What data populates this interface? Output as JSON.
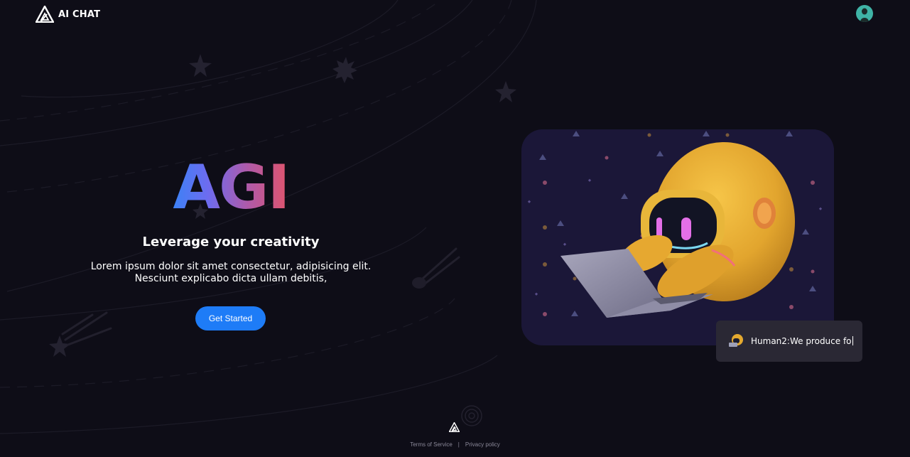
{
  "header": {
    "brand_name": "AI CHAT",
    "logo_icon": "triangle-logo-icon",
    "avatar_icon": "user-avatar-icon"
  },
  "hero": {
    "title": "AGI",
    "subtitle": "Leverage your creativity",
    "description_line1": "Lorem ipsum dolor sit amet consectetur, adipisicing elit.",
    "description_line2": "Nesciunt explicabo dicta ullam debitis,",
    "cta_label": "Get Started"
  },
  "illustration": {
    "icon": "robot-with-laptop-illustration"
  },
  "chat_bubble": {
    "text": "Human2:We produce fo",
    "avatar_icon": "robot-avatar-icon"
  },
  "footer": {
    "logo_icon": "triangle-logo-icon",
    "terms_label": "Terms of Service",
    "separator": "|",
    "privacy_label": "Privacy policy"
  },
  "colors": {
    "background": "#0e0d17",
    "accent": "#1e7cf7",
    "gradient_start": "#3b82f6",
    "gradient_end": "#e0546c",
    "bubble_bg": "#2a2834"
  }
}
